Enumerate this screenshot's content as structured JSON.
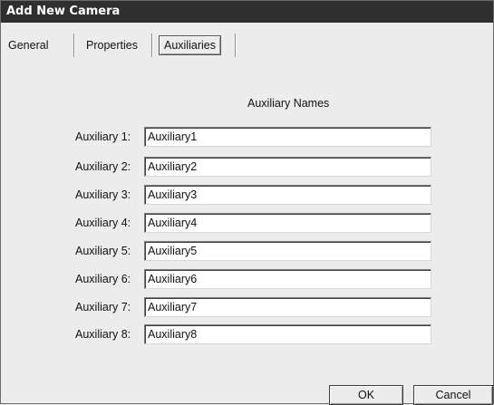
{
  "window": {
    "title": "Add New Camera"
  },
  "tabs": [
    {
      "label": "General"
    },
    {
      "label": "Properties"
    },
    {
      "label": "Auxiliaries"
    }
  ],
  "active_tab": "Auxiliaries",
  "auxiliaries": {
    "heading": "Auxiliary Names",
    "rows": [
      {
        "label": "Auxiliary 1:",
        "value": "Auxiliary1"
      },
      {
        "label": "Auxiliary 2:",
        "value": "Auxiliary2"
      },
      {
        "label": "Auxiliary 3:",
        "value": "Auxiliary3"
      },
      {
        "label": "Auxiliary 4:",
        "value": "Auxiliary4"
      },
      {
        "label": "Auxiliary 5:",
        "value": "Auxiliary5"
      },
      {
        "label": "Auxiliary 6:",
        "value": "Auxiliary6"
      },
      {
        "label": "Auxiliary 7:",
        "value": "Auxiliary7"
      },
      {
        "label": "Auxiliary 8:",
        "value": "Auxiliary8"
      }
    ]
  },
  "buttons": {
    "ok": "OK",
    "cancel": "Cancel"
  }
}
